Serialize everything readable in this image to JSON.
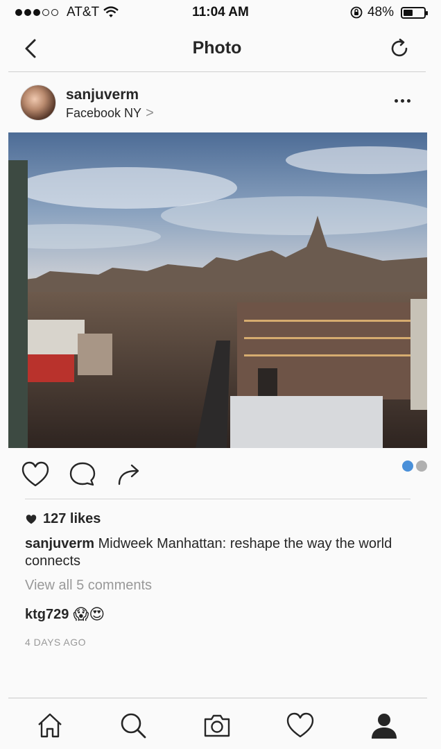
{
  "status_bar": {
    "carrier": "AT&T",
    "time": "11:04 AM",
    "battery_percent": "48%",
    "battery_level": 0.48,
    "signal_bars_filled": 3,
    "signal_bars_total": 5
  },
  "nav": {
    "title": "Photo",
    "back_icon": "chevron-left-icon",
    "refresh_icon": "refresh-icon"
  },
  "post": {
    "username": "sanjuverm",
    "location": "Facebook NY",
    "location_chevron": ">",
    "photo_alt": "Manhattan skyline at dusk",
    "likes": "127 likes",
    "caption_user": "sanjuverm",
    "caption_text": "Midweek Manhattan: reshape the way the world connects",
    "view_comments": "View all 5 comments",
    "comment_user": "ktg729",
    "comment_emojis": "😱😍",
    "timestamp": "4 DAYS AGO",
    "carousel_pages": 2,
    "carousel_active": 0
  },
  "tabs": [
    {
      "name": "home",
      "icon": "home-icon"
    },
    {
      "name": "search",
      "icon": "search-icon"
    },
    {
      "name": "camera",
      "icon": "camera-icon"
    },
    {
      "name": "activity",
      "icon": "heart-icon"
    },
    {
      "name": "profile",
      "icon": "profile-icon"
    }
  ],
  "colors": {
    "accent": "#4a90d9",
    "text": "#262626",
    "muted": "#999999"
  }
}
